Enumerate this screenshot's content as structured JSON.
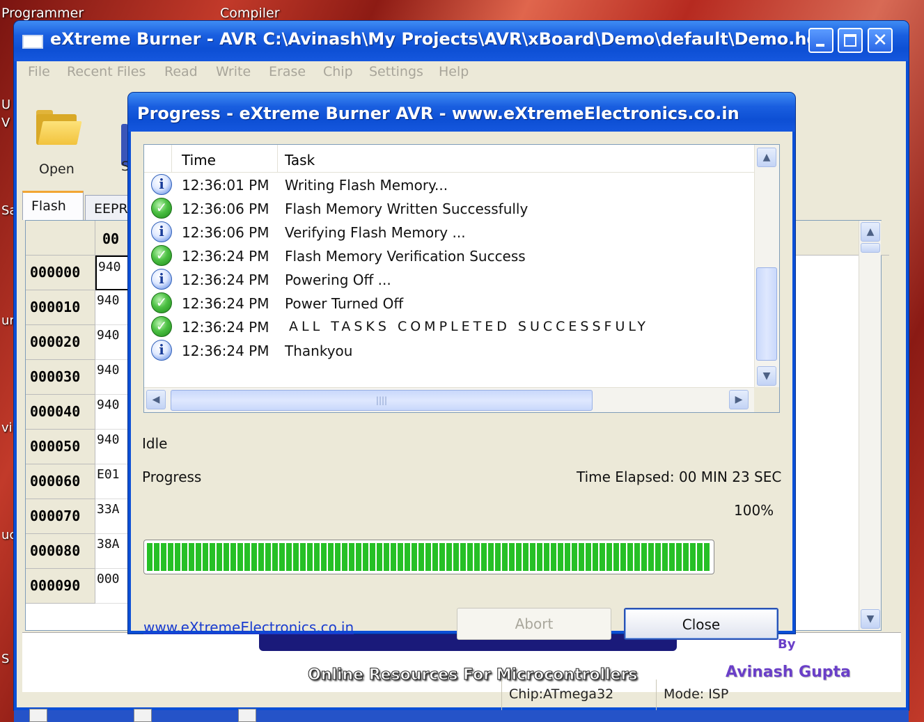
{
  "desktop": {
    "labels": [
      "Programmer",
      "Compiler"
    ],
    "fragments": [
      "U",
      "V",
      "Sa",
      "ur",
      "vi",
      "uc",
      "S"
    ]
  },
  "main_window": {
    "title": "eXtreme Burner - AVR C:\\Avinash\\My Projects\\AVR\\xBoard\\Demo\\default\\Demo.hex",
    "menu": [
      "File",
      "Recent Files",
      "Read",
      "Write",
      "Erase",
      "Chip",
      "Settings",
      "Help"
    ],
    "toolbar": {
      "open_label": "Open",
      "fragment_label": "S"
    },
    "tabs": [
      "Flash",
      "EEPR("
    ],
    "grid": {
      "column_header": "00",
      "rows": [
        {
          "addr": "000000",
          "value": "940"
        },
        {
          "addr": "000010",
          "value": "940"
        },
        {
          "addr": "000020",
          "value": "940"
        },
        {
          "addr": "000030",
          "value": "940"
        },
        {
          "addr": "000040",
          "value": "940"
        },
        {
          "addr": "000050",
          "value": "940"
        },
        {
          "addr": "000060",
          "value": "E01"
        },
        {
          "addr": "000070",
          "value": "33A"
        },
        {
          "addr": "000080",
          "value": "38A"
        },
        {
          "addr": "000090",
          "value": "000"
        }
      ]
    },
    "banner": {
      "subtitle": "Online Resources For Microcontrollers",
      "by": "By",
      "author": "Avinash Gupta"
    },
    "status": {
      "chip": "Chip:ATmega32",
      "mode": "Mode: ISP"
    }
  },
  "dialog": {
    "title": "Progress - eXtreme Burner AVR - www.eXtremeElectronics.co.in",
    "log": {
      "headers": {
        "time": "Time",
        "task": "Task"
      },
      "rows": [
        {
          "icon": "info-icon",
          "time": "12:36:01 PM",
          "task": "Writing Flash Memory..."
        },
        {
          "icon": "check-icon",
          "time": "12:36:06 PM",
          "task": "Flash Memory Written Successfully"
        },
        {
          "icon": "info-icon",
          "time": "12:36:06 PM",
          "task": "Verifying Flash Memory ..."
        },
        {
          "icon": "check-icon",
          "time": "12:36:24 PM",
          "task": "Flash Memory Verification Success"
        },
        {
          "icon": "info-icon",
          "time": "12:36:24 PM",
          "task": "Powering Off ..."
        },
        {
          "icon": "check-icon",
          "time": "12:36:24 PM",
          "task": "Power Turned Off"
        },
        {
          "icon": "check-icon",
          "time": "12:36:24 PM",
          "task": "ALL TASKS COMPLETED SUCCESSFULY"
        },
        {
          "icon": "info-icon",
          "time": "12:36:24 PM",
          "task": "Thankyou"
        }
      ]
    },
    "state_label": "Idle",
    "progress_label": "Progress",
    "time_elapsed": "Time Elapsed: 00 MIN  23 SEC",
    "progress_percent_text": "100%",
    "progress_value": 1.0,
    "link": "www.eXtremeElectronics.co.in",
    "buttons": {
      "abort": "Abort",
      "close": "Close"
    }
  },
  "colors": {
    "titlebar": "#0b4fd6",
    "progress_fill": "#26c026",
    "link": "#1a3ccf",
    "author": "#6a3fc8"
  }
}
